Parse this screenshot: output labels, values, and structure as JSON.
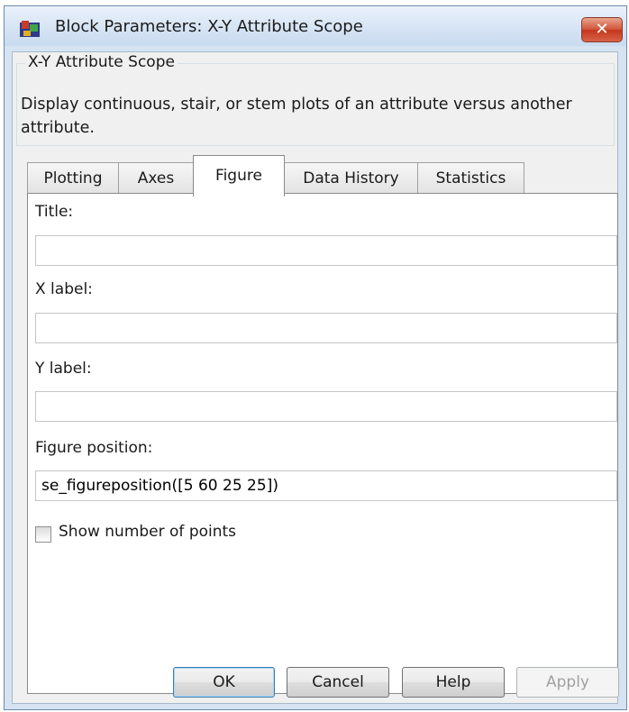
{
  "window": {
    "title": "Block Parameters: X-Y Attribute Scope",
    "close_symbol": "✕",
    "icon": "simulink-block-icon"
  },
  "group": {
    "title": "X-Y Attribute Scope",
    "description": "Display continuous, stair, or stem plots of an attribute versus another attribute."
  },
  "tabs": [
    {
      "label": "Plotting",
      "selected": false
    },
    {
      "label": "Axes",
      "selected": false
    },
    {
      "label": "Figure",
      "selected": true
    },
    {
      "label": "Data History",
      "selected": false
    },
    {
      "label": "Statistics",
      "selected": false
    }
  ],
  "fields": {
    "title": {
      "label": "Title:",
      "value": ""
    },
    "xlabel": {
      "label": "X label:",
      "value": ""
    },
    "ylabel": {
      "label": "Y label:",
      "value": ""
    },
    "figure_position": {
      "label": "Figure position:",
      "value": "se_figureposition([5 60 25 25])"
    }
  },
  "checkbox": {
    "label": "Show number of points",
    "checked": false
  },
  "buttons": {
    "ok": "OK",
    "cancel": "Cancel",
    "help": "Help",
    "apply": "Apply"
  },
  "colors": {
    "window_frame": "#d6e3f2",
    "close_button": "#c4371b",
    "default_button_border": "#3c7fb1"
  }
}
